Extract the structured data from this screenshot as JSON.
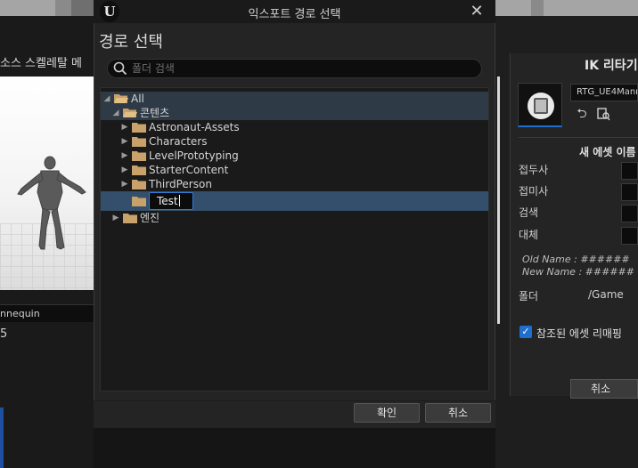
{
  "dialog": {
    "window_title": "익스포트 경로 선택",
    "logo_letter": "U",
    "close_glyph": "✕",
    "heading": "경로 선택",
    "search": {
      "placeholder": "폴더 검색",
      "value": ""
    },
    "tree": [
      {
        "label": "All",
        "expanded": true
      },
      {
        "label": "콘텐츠",
        "expanded": true
      },
      {
        "label": "Astronaut-Assets",
        "expanded": false
      },
      {
        "label": "Characters",
        "expanded": false
      },
      {
        "label": "LevelPrototyping",
        "expanded": false
      },
      {
        "label": "StarterContent",
        "expanded": false
      },
      {
        "label": "ThirdPerson",
        "expanded": false
      },
      {
        "label": "Test",
        "editing": true,
        "selected": true
      },
      {
        "label": "엔진",
        "expanded": false
      }
    ],
    "confirm_label": "확인",
    "cancel_label": "취소"
  },
  "background": {
    "left_panel_title": "소스 스켈레탈 메",
    "mannequin_label": "nnequin",
    "left_number": "5",
    "right_panel": {
      "title": "IK 리타기",
      "asset_combo": "RTG_UE4Mann",
      "section_title": "새 에셋 이름",
      "rows": [
        {
          "label": "접두사"
        },
        {
          "label": "접미사"
        },
        {
          "label": "검색"
        },
        {
          "label": "대체"
        }
      ],
      "old_name": "Old Name : ######",
      "new_name": "New Name : ######",
      "folder_label": "폴더",
      "folder_value": "/Game",
      "remap_checkbox_label": "참조된 에셋 리매핑",
      "remap_checked": true,
      "cancel_label": "취소"
    }
  },
  "colors": {
    "accent": "#1f6fd1",
    "selection": "#334f6b",
    "folder": "#c8a26a",
    "dialog_bg": "#242424"
  }
}
